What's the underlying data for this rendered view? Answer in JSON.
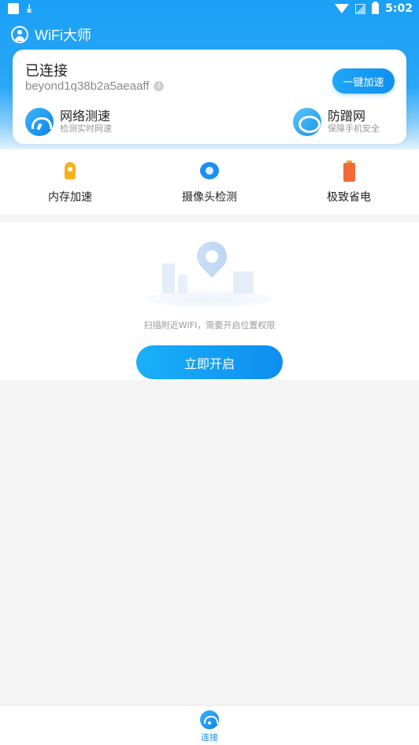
{
  "status_bar": {
    "time": "5:02",
    "download_glyph": "⤓"
  },
  "header": {
    "title": "WiFi大师",
    "icon": "user-icon"
  },
  "card": {
    "status_title": "已连接",
    "ssid": "beyond1q38b2a5aeaaff",
    "info_glyph": "i",
    "boost_label": "一键加速",
    "features": [
      {
        "name": "网络测速",
        "sub": "检测实时网速",
        "icon": "speedometer-icon"
      },
      {
        "name": "防蹭网",
        "sub": "保障手机安全",
        "icon": "shield-icon"
      }
    ]
  },
  "tools": [
    {
      "label": "内存加速",
      "icon": "rocket-icon"
    },
    {
      "label": "摄像头检测",
      "icon": "camera-icon"
    },
    {
      "label": "极致省电",
      "icon": "battery-icon"
    }
  ],
  "scan": {
    "tip": "扫描附近WIFI，需要开启位置权限",
    "button_label": "立即开启"
  },
  "bottom_nav": {
    "items": [
      {
        "label": "连接",
        "icon": "wifi-icon",
        "active": true
      }
    ]
  },
  "colors": {
    "primary": "#1B8FF0",
    "gradient_start": "#1AA0F5",
    "text": "#222222",
    "muted": "#999999"
  }
}
